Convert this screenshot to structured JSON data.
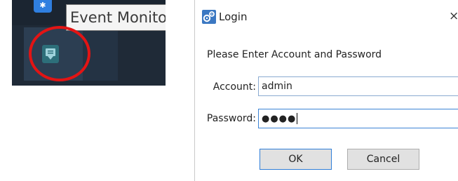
{
  "taskbar": {
    "tooltip": "Event Monitor",
    "pinned_icon": "bluetooth-icon",
    "tray_icon": "event-monitor-icon",
    "highlight_color": "#e31414"
  },
  "dialog": {
    "title": "Login",
    "app_icon": "gears-icon",
    "close_label": "×",
    "prompt": "Please Enter Account and Password",
    "account_label": "Account:",
    "account_value": "admin",
    "password_label": "Password:",
    "password_mask": "●●●●",
    "ok_label": "OK",
    "cancel_label": "Cancel",
    "accent_color": "#2f7ed8"
  }
}
